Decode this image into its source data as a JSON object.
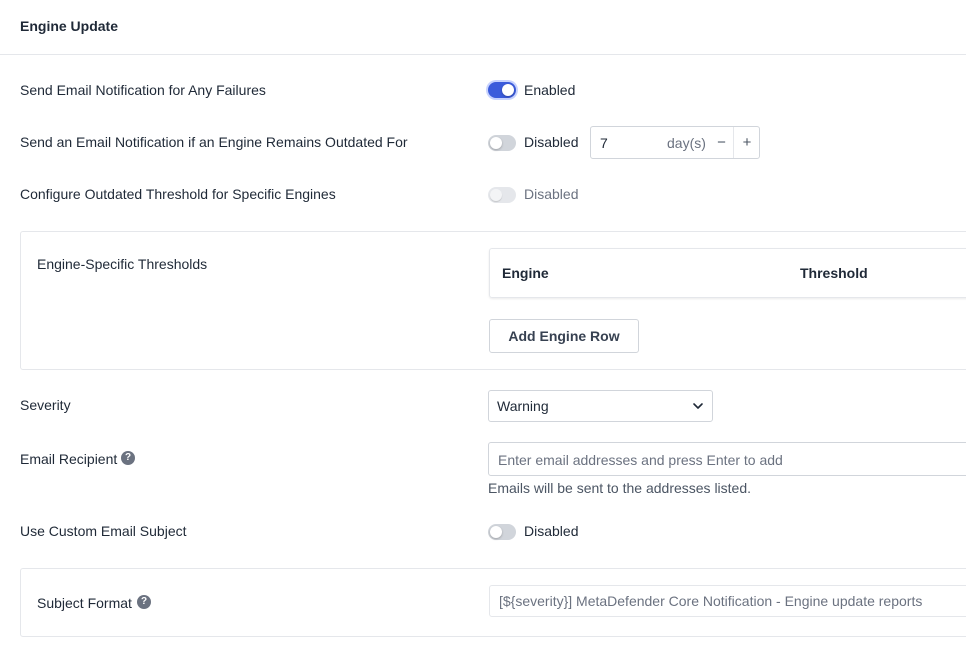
{
  "header": {
    "title": "Engine Update"
  },
  "rows": {
    "failures": {
      "label": "Send Email Notification for Any Failures",
      "toggle_state": "Enabled",
      "enabled": true
    },
    "outdated": {
      "label": "Send an Email Notification if an Engine Remains Outdated For",
      "toggle_state": "Disabled",
      "enabled": false,
      "days_value": "7",
      "days_unit": "day(s)",
      "minus": "−",
      "plus": "+"
    },
    "threshold": {
      "label": "Configure Outdated Threshold for Specific Engines",
      "toggle_state": "Disabled",
      "enabled": false
    }
  },
  "engine_panel": {
    "label": "Engine-Specific Thresholds",
    "columns": [
      "Engine",
      "Threshold"
    ],
    "add_button": "Add Engine Row"
  },
  "severity": {
    "label": "Severity",
    "selected": "Warning"
  },
  "email": {
    "label": "Email Recipient",
    "help_icon": "?",
    "placeholder": "Enter email addresses and press Enter to add",
    "hint": "Emails will be sent to the addresses listed."
  },
  "custom_subject": {
    "label": "Use Custom Email Subject",
    "toggle_state": "Disabled",
    "enabled": false
  },
  "subject_panel": {
    "label": "Subject Format",
    "help_icon": "?",
    "value": "[${severity}] MetaDefender Core Notification - Engine update reports"
  },
  "colors": {
    "accent": "#3b5bdb",
    "border": "#e5e7eb",
    "muted_text": "#6b7280"
  }
}
